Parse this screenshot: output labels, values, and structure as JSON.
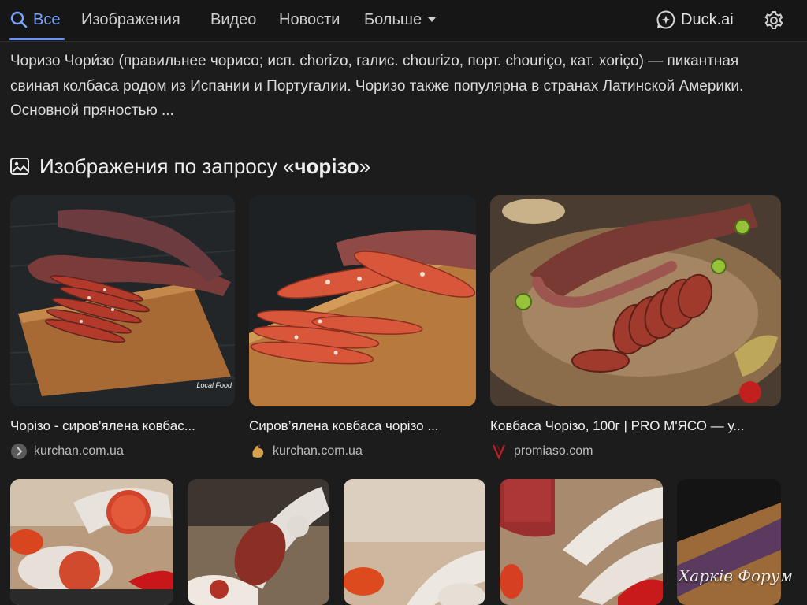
{
  "nav": {
    "tabs": [
      {
        "label": "Все",
        "active": true
      },
      {
        "label": "Изображения"
      },
      {
        "label": "Видео"
      },
      {
        "label": "Новости"
      },
      {
        "label": "Больше"
      }
    ],
    "duck_ai_label": "Duck.ai",
    "accent_color": "#7aa6ff"
  },
  "snippet": {
    "text": "Чоризо Чори́зо (правильнее чорисо; исп. chorizo, галис. chourizo, порт. chouriço, кат. xoriço) — пикантная свиная колбаса родом из Испании и Португалии. Чоризо также популярна в странах Латинской Америки. Основной пряностью ..."
  },
  "images_section": {
    "title_prefix": "Изображения по запросу «",
    "query": "чорізо",
    "title_suffix": "»",
    "results": [
      {
        "caption": "Чорізо - сиров'ялена ковбас...",
        "source": "kurchan.com.ua",
        "overlay": "Local Food"
      },
      {
        "caption": "Сиров’ялена ковбаса чорізо ...",
        "source": "kurchan.com.ua"
      },
      {
        "caption": "Ковбаса Чорізо, 100г | PRO М'ЯСО — у...",
        "source": "promiaso.com"
      }
    ],
    "watermark": "Харків Форум"
  }
}
